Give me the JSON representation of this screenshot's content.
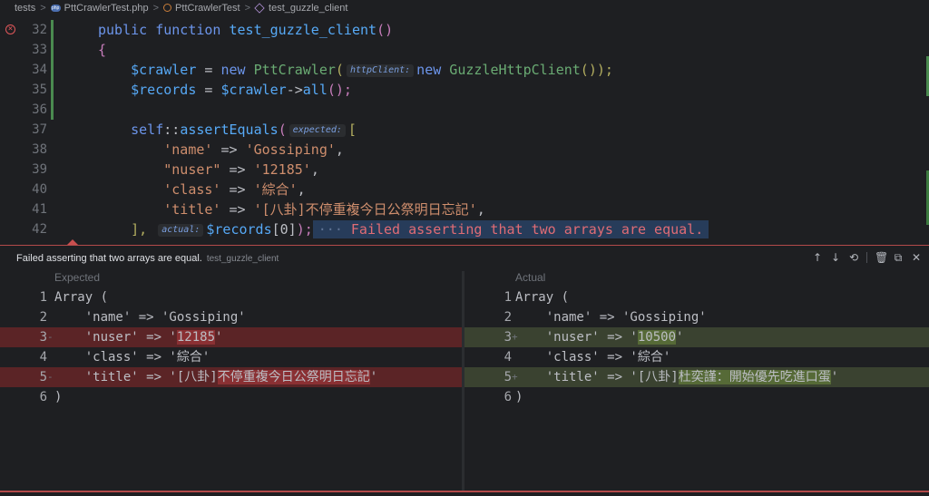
{
  "breadcrumb": {
    "items": [
      {
        "label": "tests",
        "icon": "folder"
      },
      {
        "label": "PttCrawlerTest.php",
        "icon": "php-file-icon"
      },
      {
        "label": "PttCrawlerTest",
        "icon": "class-icon"
      },
      {
        "label": "test_guzzle_client",
        "icon": "method-icon"
      }
    ],
    "separator": ">",
    "php_badge": "php"
  },
  "editor": {
    "line_numbers": [
      "32",
      "33",
      "34",
      "35",
      "36",
      "37",
      "38",
      "39",
      "40",
      "41",
      "42"
    ],
    "lines": {
      "l32": {
        "kw1": "public",
        "kw2": "function",
        "fn": "test_guzzle_client",
        "paren": "()"
      },
      "l33": {
        "brace": "{"
      },
      "l34": {
        "var": "$crawler",
        "op": " = ",
        "kw": "new",
        "cls": "PttCrawler",
        "open": "(",
        "hint": "httpClient:",
        "kw2": "new",
        "cls2": "GuzzleHttpClient",
        "close": "());"
      },
      "l35": {
        "var": "$records",
        "op": " = ",
        "var2": "$crawler",
        "arrow": "->",
        "fn": "all",
        "close": "();"
      },
      "l37": {
        "kw": "self",
        "op": "::",
        "fn": "assertEquals",
        "open": "(",
        "hint": "expected:",
        "bracket": "["
      },
      "l38": {
        "key": "'name'",
        "op": " => ",
        "val": "'Gossiping'",
        "comma": ","
      },
      "l39": {
        "key": "\"nuser\"",
        "op": " => ",
        "val": "'12185'",
        "comma": ","
      },
      "l40": {
        "key": "'class'",
        "op": " => ",
        "val": "'綜合'",
        "comma": ","
      },
      "l41": {
        "key": "'title'",
        "op": " => ",
        "val": "'[八卦]不停重複今日公祭明日忘記'",
        "comma": ","
      },
      "l42": {
        "bracket": "],",
        "hint": "actual:",
        "var": "$records",
        "idx": "[0]",
        "close": ");",
        "dots": "···",
        "error": "Failed asserting that two arrays are equal."
      }
    }
  },
  "panel": {
    "title": "Failed asserting that two arrays are equal.",
    "subtitle": "test_guzzle_client",
    "tools": {
      "up": "↑",
      "down": "↓",
      "history": "⟲",
      "delete": "🗑",
      "copy": "⧉",
      "close": "✕"
    },
    "expected": {
      "label": "Expected",
      "lines": [
        {
          "n": "1",
          "marker": "",
          "text": "Array ("
        },
        {
          "n": "2",
          "marker": "",
          "text": "    'name' => 'Gossiping'"
        },
        {
          "n": "3",
          "marker": "-",
          "pre": "    'nuser' => '",
          "hl": "12185",
          "post": "'"
        },
        {
          "n": "4",
          "marker": "",
          "text": "    'class' => '綜合'"
        },
        {
          "n": "5",
          "marker": "-",
          "pre": "    'title' => '[八卦]",
          "hl": "不停重複今日公祭明日忘記",
          "post": "'"
        },
        {
          "n": "6",
          "marker": "",
          "text": ")"
        }
      ]
    },
    "actual": {
      "label": "Actual",
      "lines": [
        {
          "n": "1",
          "marker": "",
          "text": "Array ("
        },
        {
          "n": "2",
          "marker": "",
          "text": "    'name' => 'Gossiping'"
        },
        {
          "n": "3",
          "marker": "+",
          "pre": "    'nuser' => '",
          "hl": "10500",
          "post": "'"
        },
        {
          "n": "4",
          "marker": "",
          "text": "    'class' => '綜合'"
        },
        {
          "n": "5",
          "marker": "+",
          "pre": "    'title' => '[八卦]",
          "hl": "杜奕謹：開始優先吃進口蛋",
          "post": "'"
        },
        {
          "n": "6",
          "marker": "",
          "text": ")"
        }
      ]
    }
  },
  "colors": {
    "background": "#1e1f22",
    "error": "#e0575a",
    "deleted_line": "#5b2426",
    "added_line": "#3a4230",
    "vcs_added": "#4a8a4f"
  }
}
